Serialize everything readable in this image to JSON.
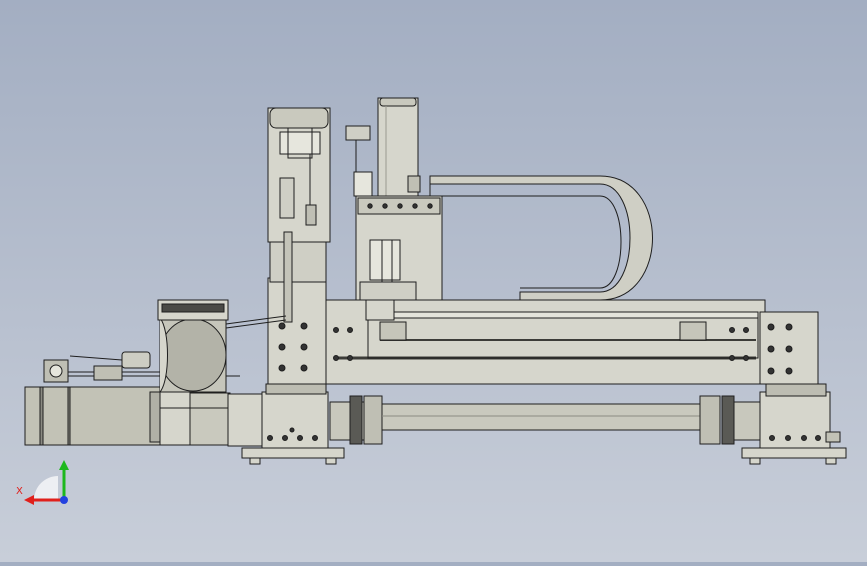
{
  "viewport": {
    "background_top": "#a3aec2",
    "background_bottom": "#c8ced9"
  },
  "model": {
    "part_color": "#d6d6cc",
    "shade_color": "#b9b9ae",
    "dark_color": "#6f6f68",
    "edge_color": "#1e1e1e"
  },
  "triad": {
    "x_label": "X",
    "x_color": "#e0201c",
    "y_color": "#1db81d",
    "z_color": "#2342e0"
  }
}
